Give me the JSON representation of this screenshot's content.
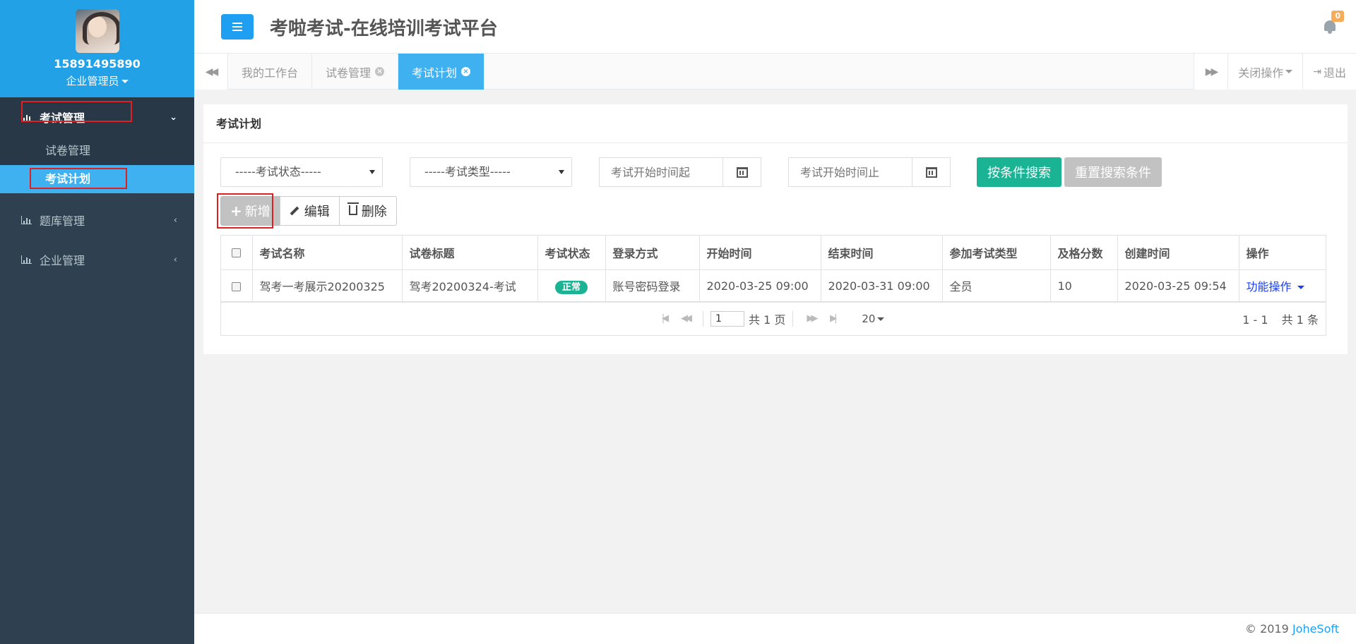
{
  "user": {
    "phone": "15891495890",
    "role": "企业管理员"
  },
  "sidebar": {
    "groups": [
      {
        "label": "考试管理",
        "arrow": "⌄",
        "items": [
          {
            "label": "试卷管理"
          },
          {
            "label": "考试计划"
          }
        ]
      },
      {
        "label": "题库管理",
        "arrow": "‹"
      },
      {
        "label": "企业管理",
        "arrow": "‹"
      }
    ]
  },
  "header": {
    "title": "考啦考试-在线培训考试平台",
    "notification_count": "0"
  },
  "tabs": [
    {
      "label": "我的工作台"
    },
    {
      "label": "试卷管理"
    },
    {
      "label": "考试计划"
    }
  ],
  "tabbar": {
    "close_ops": "关闭操作",
    "logout": "退出"
  },
  "page": {
    "title": "考试计划",
    "filters": {
      "status_placeholder": "-----考试状态-----",
      "type_placeholder": "-----考试类型-----",
      "start_from_placeholder": "考试开始时间起",
      "start_to_placeholder": "考试开始时间止",
      "search_label": "按条件搜索",
      "reset_label": "重置搜索条件"
    },
    "toolbar": {
      "add": "新增",
      "edit": "编辑",
      "delete": "删除"
    }
  },
  "table": {
    "columns": [
      "考试名称",
      "试卷标题",
      "考试状态",
      "登录方式",
      "开始时间",
      "结束时间",
      "参加考试类型",
      "及格分数",
      "创建时间",
      "操作"
    ],
    "rows": [
      {
        "name": "驾考一考展示20200325",
        "paper": "驾考20200324-考试",
        "status": "正常",
        "login": "账号密码登录",
        "start": "2020-03-25 09:00",
        "end": "2020-03-31 09:00",
        "participants": "全员",
        "pass_score": "10",
        "created": "2020-03-25 09:54",
        "action": "功能操作"
      }
    ]
  },
  "pagination": {
    "current_page": "1",
    "total_pages_text": "共 1 页",
    "page_size": "20",
    "range": "1 - 1",
    "total_text": "共 1 条"
  },
  "footer": {
    "copyright": "© 2019",
    "brand": "JoheSoft"
  },
  "colors": {
    "sidebar": "#2f4050",
    "profile": "#23a1e6",
    "active_tab": "#3fb1f0",
    "primary": "#1e9ff2",
    "success": "#1ab394",
    "highlight": "#e02020"
  }
}
